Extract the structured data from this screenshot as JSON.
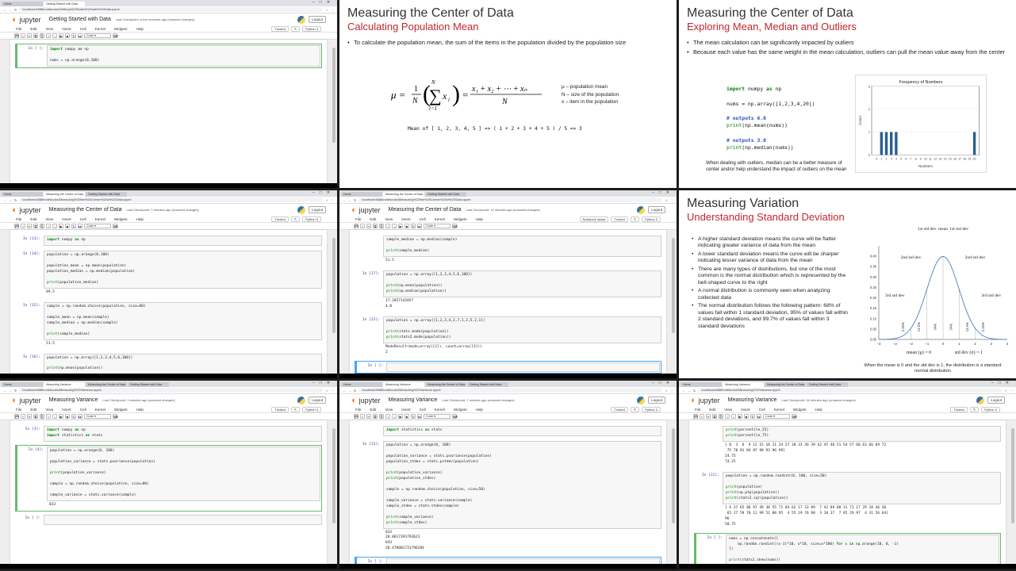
{
  "tabs": {
    "t0": [
      "Home",
      "Getting Started with Data",
      ""
    ],
    "t3": [
      "Home",
      "Measuring the Center of Data",
      "Getting Started with Data"
    ],
    "t4": [
      "Home",
      "Measuring the Center of Data",
      "Getting Started with Data"
    ],
    "t6": [
      "Home",
      "Measuring Variance",
      "Measuring the Center of Data",
      "Getting Started with Data"
    ],
    "t7": [
      "Home",
      "Measuring Variance",
      "Measuring the Center of Data",
      "Getting Started with Data"
    ],
    "t8": [
      "Home",
      "Measuring Variance",
      "Measuring the Center of Data",
      "Getting Started with Data"
    ]
  },
  "urls": {
    "t0": "localhost:8888/notebooks/Getting%20Started%20with%20Data.ipynb",
    "t3": "localhost:8888/notebooks/Measuring%20the%20Center%20of%20Data.ipynb",
    "t4": "localhost:8888/notebooks/Measuring%20the%20Center%20of%20Data.ipynb",
    "t6": "localhost:8888/notebooks/Measuring%20Variance.ipynb",
    "t7": "localhost:8888/notebooks/Measuring%20Variance.ipynb",
    "t8": "localhost:8888/notebooks/Measuring%20Variance.ipynb"
  },
  "jupyter": {
    "brand": "jupyter",
    "logout": "Logout",
    "trusted": "Trusted",
    "notebook_saved": "Notebook saved",
    "kernel": "Python 3",
    "menu": [
      "File",
      "Edit",
      "View",
      "Insert",
      "Cell",
      "Kernel",
      "Widgets",
      "Help"
    ],
    "celltype": "Code"
  },
  "nb": {
    "t0": {
      "title": "Getting Started with Data",
      "ckpt": "Last Checkpoint: a few seconds ago (unsaved changes)"
    },
    "t3": {
      "title": "Measuring the Center of Data",
      "ckpt": "Last Checkpoint: 7 minutes ago (unsaved changes)"
    },
    "t4": {
      "title": "Measuring the Center of Data",
      "ckpt": "Last Checkpoint: 12 minutes ago (unsaved changes)"
    },
    "t6": {
      "title": "Measuring Variance",
      "ckpt": "Last Checkpoint: 3 minutes ago (unsaved changes)"
    },
    "t7": {
      "title": "Measuring Variance",
      "ckpt": "Last Checkpoint: 7 minutes ago (unsaved changes)"
    },
    "t8": {
      "title": "Measuring Variance",
      "ckpt": "Last Checkpoint: 16 minutes ago (unsaved changes)"
    }
  },
  "cells": {
    "t0": [
      {
        "prompt": "In [ ]:",
        "code": "import numpy as np\n\nnums = np.arange(0,100)",
        "out": "",
        "state": "green"
      }
    ],
    "t3": [
      {
        "prompt": "In [13]:",
        "code": "import numpy as np",
        "out": "",
        "state": ""
      },
      {
        "prompt": "In [14]:",
        "code": "population = np.arange(0,100)\n\npopulation_mean = np.mean(population)\npopulation_median = np.median(population)\n\nprint(population_median)",
        "out": "49.5",
        "state": ""
      },
      {
        "prompt": "In [15]:",
        "code": "sample = np.random.choice(population, size=80)\n\nsample_mean = np.mean(sample)\nsample_median = np.median(sample)\n\nprint(sample_median)",
        "out": "51.5",
        "state": ""
      },
      {
        "prompt": "In [16]:",
        "code": "population = np.array([1,2,3,4,5,6,100])\n\nprint(np.mean(population))",
        "out": "17.285714285",
        "state": ""
      },
      {
        "prompt": "In [ ]:",
        "code": "",
        "out": "",
        "state": "sel"
      }
    ],
    "t4": [
      {
        "prompt": "",
        "code": "sample_median = np.median(sample)\n\nprint(sample_median)",
        "out": "51.5",
        "state": ""
      },
      {
        "prompt": "In [17]:",
        "code": "population = np.array([1,2,3,4,5,6,100])\n\nprint(np.mean(population))\nprint(np.median(population))",
        "out": "17.2857142857\n4.0",
        "state": ""
      },
      {
        "prompt": "In [22]:",
        "code": "population = np.array([1,2,3,4,2,7,1,2,5,2,1])\n\nprint(stats.mode(population))\nprint(stats2.mode(population))",
        "out": "ModeResult(mode=array([2]), count=array([4]))\n2",
        "state": ""
      },
      {
        "prompt": "In [ ]:",
        "code": "",
        "out": "",
        "state": "sel"
      }
    ],
    "t6": [
      {
        "prompt": "In [3]:",
        "code": "import numpy as np\nimport statistics as stats",
        "out": "",
        "state": ""
      },
      {
        "prompt": "In [4]:",
        "code": "population = np.arange(0, 100)\n\npopulation_variance = stats.pvariance(population)\n\nprint(population_variance)\n\nsample = np.random.choice(population, size=80)\n\nsample_variance = stats.variance(sample)",
        "out": "833",
        "state": "green"
      },
      {
        "prompt": "In [ ]:",
        "code": "",
        "out": "",
        "state": ""
      }
    ],
    "t7": [
      {
        "prompt": "",
        "code": "import statistics as stats",
        "out": "",
        "state": ""
      },
      {
        "prompt": "In [15]:",
        "code": "population = np.arange(0, 100)\n\npopulation_variance = stats.pvariance(population)\npopulation_stdev = stats.pstdev(population)\n\nprint(population_variance)\nprint(population_stdev)\n\nsample = np.random.choice(population, size=50)\n\nsample_variance = stats.variance(sample)\nsample_stdev = stats.stdev(sample)\n\nprint(sample_variance)\nprint(sample_stdev)",
        "out": "833\n28.8617393793623\n833\n28.478001731796284",
        "state": ""
      },
      {
        "prompt": "In [ ]:",
        "code": "",
        "out": "",
        "state": "sel"
      },
      {
        "prompt": "In [ ]:",
        "code": "",
        "out": "",
        "state": ""
      }
    ],
    "t8": [
      {
        "prompt": "",
        "code": "print(percentile_25)\nprint(percentile_75)",
        "out": "[ 0  3  6  9 12 15 18 21 24 27 30 33 36 39 42 45 48 51 54 57 60 63 66 69 72\n 75 78 81 84 87 90 93 96 99]\n24.75\n74.25",
        "state": ""
      },
      {
        "prompt": "In [22]:",
        "code": "population = np.random.randint(0, 100, size=50)\n\nprint(population)\nprint(np.ptp(population))\nprint(stats2.iqr(population))",
        "out": "[ 6 37 65 86 97 49 30 55 71 84 62 17 33 89  7 42 89 88 31 71 17 29 18 46 36\n 65 27 59 70 11 99 51 80 95  4 55 19 76 98  3 18 37  7 85 29 97  4 31 56 64]\n96\n50.75",
        "state": ""
      },
      {
        "prompt": "In [ ]:",
        "code": "nums = np.concatenate([\n    np.random.randint((x-1)*10, x*10, size=x*100) for x in np.arange(10, 0, -1)\n])\n\nprint(stats2.skew(nums))\n\nplt.hist(nums, bins=100)\nplt.sh",
        "out": "",
        "state": "green"
      }
    ]
  },
  "slide1": {
    "title": "Measuring the Center of Data",
    "subtitle": "Calculating Population Mean",
    "bullets": [
      "To calculate the population mean, the sum of the items in the population divided by the population size"
    ],
    "legend": [
      "μ – population mean",
      "N – size of the population",
      "x – item in the population"
    ],
    "example": "Mean of [ 1, 2, 3, 4, 5 ] => ( 1 + 2 + 3 + 4 + 5 ) / 5 => 3"
  },
  "slide2": {
    "title": "Measuring the Center of Data",
    "subtitle": "Exploring Mean, Median and Outliers",
    "bullets": [
      "The mean calculation can be significantly impacted by outliers",
      "Because each value has the same weight in the mean calculation, outliers can pull the mean value away from the center"
    ],
    "code": [
      {
        "t": "import numpy as np",
        "c": "code"
      },
      {
        "t": "",
        "c": "code"
      },
      {
        "t": "nums = np.array([1,2,3,4,20])",
        "c": "code"
      },
      {
        "t": "",
        "c": "code"
      },
      {
        "t": "# outputs 6.0",
        "c": "cmt"
      },
      {
        "t": "print(np.mean(nums))",
        "c": "code"
      },
      {
        "t": "",
        "c": "code"
      },
      {
        "t": "# outputs 3.0",
        "c": "cmt"
      },
      {
        "t": "print(np.median(nums))",
        "c": "code"
      }
    ],
    "note": "When dealing with outliers, median can be a better measure of center and/or help understand the impact of outliers on the mean"
  },
  "slide3": {
    "title": "Measuring Variation",
    "subtitle": "Understanding Standard Deviation",
    "bullets": [
      "A higher standard deviation means the curve will be flatter indicating greater variance of data from the mean",
      "A lower standard deviation means the curve will be sharper indicating lesser variance of data from the mean",
      "There are many types of distributions, but one of the most common is the normal distribution which is represented by the bell-shaped curve to the right",
      "A normal distribution is commonly seen when analyzing collected data",
      "The normal distribution follows the following pattern: 68% of values fall within 1 standard deviation, 95% of values fall within 2 standard deviations, and 99.7% of values fall within 3 standard deviations"
    ],
    "labels": {
      "sd1": "1st std dev",
      "mean": "mean",
      "sd2": "2nd std dev",
      "sd3": "3rd std dev",
      "p1": "34%",
      "p2": "13.5%",
      "p3": "2.35%",
      "bottom_mean": "mean (μ) = 0",
      "bottom_sd": "std dev (σ) = 1"
    },
    "caption": "When the mean is 0 and the std dev is 1, the distribution is a standard normal distribution"
  },
  "chart_data": [
    {
      "type": "bar",
      "title": "Frequency of Numbers",
      "xlabel": "Numbers",
      "ylabel": "Count",
      "x": [
        1,
        2,
        3,
        4,
        20
      ],
      "values": [
        1,
        1,
        1,
        1,
        1
      ],
      "xlim": [
        0,
        20
      ],
      "ylim": [
        0,
        3
      ],
      "xticks": [
        0,
        1,
        2,
        3,
        4,
        5,
        6,
        7,
        8,
        9,
        10,
        11,
        12,
        13,
        14,
        15,
        16,
        17,
        18,
        19,
        20
      ],
      "yticks": [
        0,
        1,
        2,
        3
      ],
      "bar_color": "#2a5f8f"
    },
    {
      "type": "line",
      "title": "",
      "x_range": [
        -4,
        4
      ],
      "y_range": [
        0,
        0.45
      ],
      "mean": 0,
      "std": 1,
      "xticks": [
        -4,
        -3,
        -2,
        -1,
        0,
        1,
        2,
        3,
        4
      ],
      "yticks": [
        0.0,
        0.05,
        0.1,
        0.15,
        0.2,
        0.25,
        0.3,
        0.35,
        0.4
      ],
      "line_color": "#4a7fbf"
    }
  ]
}
